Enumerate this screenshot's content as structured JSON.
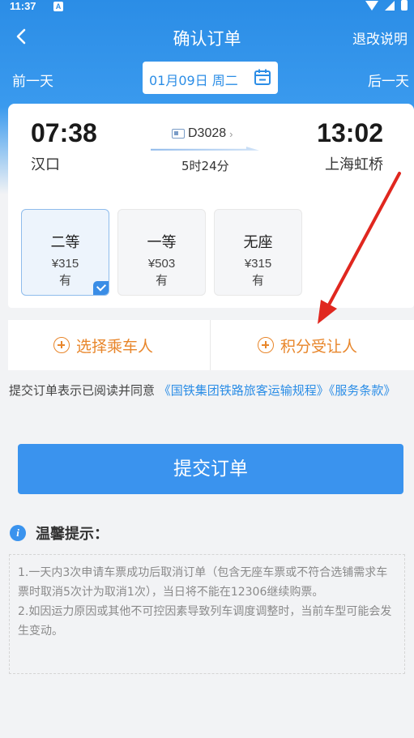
{
  "status_bar": {
    "time": "11:37",
    "notification_letter": "A"
  },
  "header": {
    "title": "确认订单",
    "refund_link": "退改说明"
  },
  "date_nav": {
    "prev": "前一天",
    "next": "后一天",
    "date": "01月09日 周二"
  },
  "train": {
    "departure_time": "07:38",
    "arrival_time": "13:02",
    "departure_station": "汉口",
    "arrival_station": "上海虹桥",
    "number": "D3028",
    "duration": "5时24分"
  },
  "seats": [
    {
      "class": "二等",
      "price": "¥315",
      "availability": "有",
      "selected": true
    },
    {
      "class": "一等",
      "price": "¥503",
      "availability": "有",
      "selected": false
    },
    {
      "class": "无座",
      "price": "¥315",
      "availability": "有",
      "selected": false
    }
  ],
  "passenger": {
    "select_label": "选择乘车人",
    "points_label": "积分受让人"
  },
  "agreement": {
    "prefix": "提交订单表示已阅读并同意",
    "link1": "《国铁集团铁路旅客运输规程》",
    "link2": "《服务条款》"
  },
  "submit_label": "提交订单",
  "tips": {
    "title": "温馨提示：",
    "line1": "1.一天内3次申请车票成功后取消订单（包含无座车票或不符合选铺需求车票时取消5次计为取消1次），当日将不能在12306继续购票。",
    "line2": "2.如因运力原因或其他不可控因素导致列车调度调整时，当前车型可能会发生变动。"
  },
  "colors": {
    "primary": "#3a93ee",
    "accent": "#e8862b",
    "annotation": "#e0271f"
  }
}
